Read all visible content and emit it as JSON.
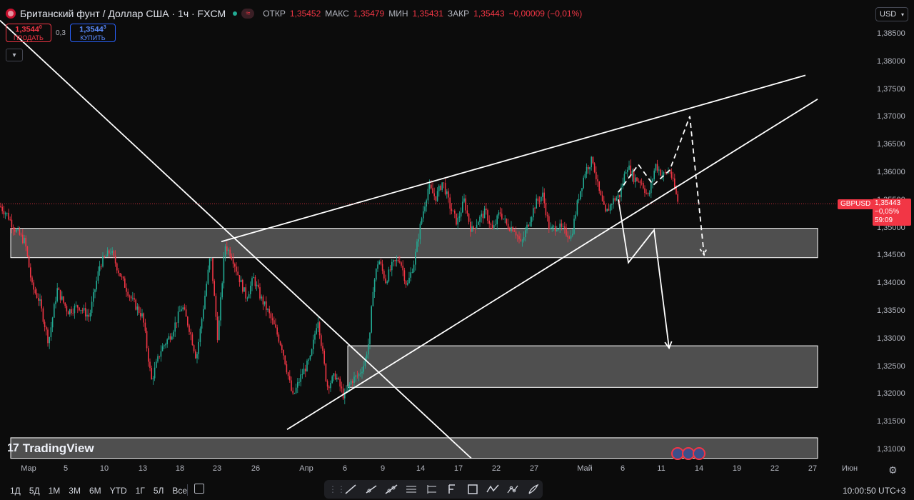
{
  "header": {
    "symbol_title": "Британский фунт / Доллар США · 1ч · FXCM",
    "ohlc": [
      {
        "label": "ОТКР",
        "value": "1,35452"
      },
      {
        "label": "МАКС",
        "value": "1,35479"
      },
      {
        "label": "МИН",
        "value": "1,35431"
      },
      {
        "label": "ЗАКР",
        "value": "1,35443"
      }
    ],
    "change": "−0,00009 (−0,01%)"
  },
  "trade": {
    "sell_price": "1,3544",
    "sell_price_sup": "0",
    "sell_label": "ПРОДАТЬ",
    "spread": "0,3",
    "buy_price": "1,3544",
    "buy_price_sup": "3",
    "buy_label": "КУПИТЬ"
  },
  "currency_selector": "USD",
  "price_axis": {
    "ticks": [
      "1,38500",
      "1,38000",
      "1,37500",
      "1,37000",
      "1,36500",
      "1,36000",
      "1,35500",
      "1,35000",
      "1,34500",
      "1,34000",
      "1,33500",
      "1,33000",
      "1,32500",
      "1,32000",
      "1,31500",
      "1,31000"
    ],
    "tick_values": [
      1.385,
      1.38,
      1.375,
      1.37,
      1.365,
      1.36,
      1.355,
      1.35,
      1.345,
      1.34,
      1.335,
      1.33,
      1.325,
      1.32,
      1.315,
      1.31
    ]
  },
  "last_price": {
    "symbol": "GBPUSD",
    "price": "1,35443",
    "change_pct": "−0,05%",
    "countdown": "59:09"
  },
  "time_axis": {
    "labels": [
      "Мар",
      "5",
      "10",
      "13",
      "18",
      "23",
      "26",
      "Апр",
      "6",
      "9",
      "14",
      "17",
      "22",
      "27",
      "Май",
      "6",
      "11",
      "14",
      "19",
      "22",
      "27",
      "Июн"
    ]
  },
  "branding": {
    "logo_text": "TradingView",
    "logo_mark": "17"
  },
  "timeframes": [
    "1Д",
    "5Д",
    "1М",
    "3М",
    "6М",
    "YTD",
    "1Г",
    "5Л",
    "Все"
  ],
  "drawing_tools": [
    "trend-line-tool",
    "ray-tool",
    "extended-line-tool",
    "parallel-channel-tool",
    "pitchfork-tool",
    "fib-tool",
    "rectangle-tool",
    "zigzag-tool",
    "path-tool",
    "brush-tool"
  ],
  "clock": "10:00:50 UTC+3",
  "colors": {
    "up": "#22ab94",
    "down": "#f23645",
    "buy": "#2962ff",
    "drawing": "#ffffff",
    "background": "#0c0c0c"
  },
  "chart_data": {
    "type": "candlestick",
    "title": "Британский фунт / Доллар США · 1ч · FXCM",
    "ylim": [
      1.3085,
      1.3885
    ],
    "price_path": [
      [
        0,
        1.354
      ],
      [
        10,
        1.3525
      ],
      [
        20,
        1.35
      ],
      [
        35,
        1.3475
      ],
      [
        45,
        1.3395
      ],
      [
        55,
        1.337
      ],
      [
        68,
        1.3295
      ],
      [
        80,
        1.339
      ],
      [
        95,
        1.335
      ],
      [
        110,
        1.336
      ],
      [
        125,
        1.334
      ],
      [
        140,
        1.3435
      ],
      [
        155,
        1.346
      ],
      [
        170,
        1.341
      ],
      [
        185,
        1.337
      ],
      [
        200,
        1.334
      ],
      [
        212,
        1.3225
      ],
      [
        225,
        1.328
      ],
      [
        240,
        1.331
      ],
      [
        255,
        1.336
      ],
      [
        265,
        1.332
      ],
      [
        275,
        1.3265
      ],
      [
        285,
        1.336
      ],
      [
        295,
        1.3455
      ],
      [
        305,
        1.33
      ],
      [
        315,
        1.347
      ],
      [
        325,
        1.345
      ],
      [
        335,
        1.341
      ],
      [
        345,
        1.3375
      ],
      [
        355,
        1.341
      ],
      [
        365,
        1.3375
      ],
      [
        375,
        1.335
      ],
      [
        385,
        1.332
      ],
      [
        395,
        1.3285
      ],
      [
        410,
        1.3195
      ],
      [
        422,
        1.3235
      ],
      [
        435,
        1.3265
      ],
      [
        445,
        1.334
      ],
      [
        458,
        1.3215
      ],
      [
        470,
        1.3235
      ],
      [
        482,
        1.3195
      ],
      [
        492,
        1.3225
      ],
      [
        502,
        1.3235
      ],
      [
        510,
        1.3255
      ],
      [
        518,
        1.3305
      ],
      [
        522,
        1.339
      ],
      [
        530,
        1.3445
      ],
      [
        540,
        1.3405
      ],
      [
        550,
        1.3435
      ],
      [
        560,
        1.3445
      ],
      [
        570,
        1.3395
      ],
      [
        580,
        1.344
      ],
      [
        590,
        1.3515
      ],
      [
        600,
        1.3575
      ],
      [
        610,
        1.3555
      ],
      [
        620,
        1.3585
      ],
      [
        630,
        1.354
      ],
      [
        640,
        1.351
      ],
      [
        650,
        1.355
      ],
      [
        660,
        1.3495
      ],
      [
        670,
        1.3515
      ],
      [
        680,
        1.353
      ],
      [
        690,
        1.3495
      ],
      [
        700,
        1.353
      ],
      [
        710,
        1.3505
      ],
      [
        720,
        1.35
      ],
      [
        730,
        1.347
      ],
      [
        740,
        1.351
      ],
      [
        750,
        1.3545
      ],
      [
        760,
        1.356
      ],
      [
        770,
        1.3495
      ],
      [
        780,
        1.3505
      ],
      [
        790,
        1.3495
      ],
      [
        800,
        1.3485
      ],
      [
        810,
        1.3555
      ],
      [
        820,
        1.3605
      ],
      [
        830,
        1.3625
      ],
      [
        838,
        1.357
      ],
      [
        848,
        1.3525
      ],
      [
        858,
        1.355
      ],
      [
        868,
        1.356
      ],
      [
        878,
        1.3615
      ],
      [
        888,
        1.359
      ],
      [
        898,
        1.3585
      ],
      [
        908,
        1.3555
      ],
      [
        918,
        1.3615
      ],
      [
        928,
        1.3595
      ],
      [
        938,
        1.3605
      ],
      [
        945,
        1.357
      ],
      [
        950,
        1.3545
      ]
    ],
    "zones": [
      {
        "name": "upper-zone",
        "price_top": 1.35,
        "price_bottom": 1.3447
      },
      {
        "name": "middle-zone",
        "price_top": 1.3288,
        "price_bottom": 1.3213
      },
      {
        "name": "lower-zone",
        "price_top": 1.3122,
        "price_bottom": 1.3085
      }
    ],
    "drawings": [
      {
        "name": "descending-trendline",
        "points": [
          [
            0,
            1.3875
          ],
          [
            660,
            1.3085
          ]
        ]
      },
      {
        "name": "wedge-upper-line",
        "points": [
          [
            310,
            1.3476
          ],
          [
            1128,
            1.3776
          ]
        ]
      },
      {
        "name": "wedge-lower-line",
        "points": [
          [
            402,
            1.3137
          ],
          [
            1145,
            1.3733
          ]
        ]
      },
      {
        "name": "projection-solid-path",
        "points": [
          [
            866,
            1.3552
          ],
          [
            880,
            1.3438
          ],
          [
            916,
            1.3497
          ],
          [
            937,
            1.3284
          ]
        ]
      },
      {
        "name": "projection-dashed-path",
        "points": [
          [
            866,
            1.3565
          ],
          [
            894,
            1.3615
          ],
          [
            915,
            1.3578
          ],
          [
            938,
            1.3605
          ],
          [
            966,
            1.3702
          ],
          [
            986,
            1.3452
          ]
        ]
      }
    ]
  }
}
